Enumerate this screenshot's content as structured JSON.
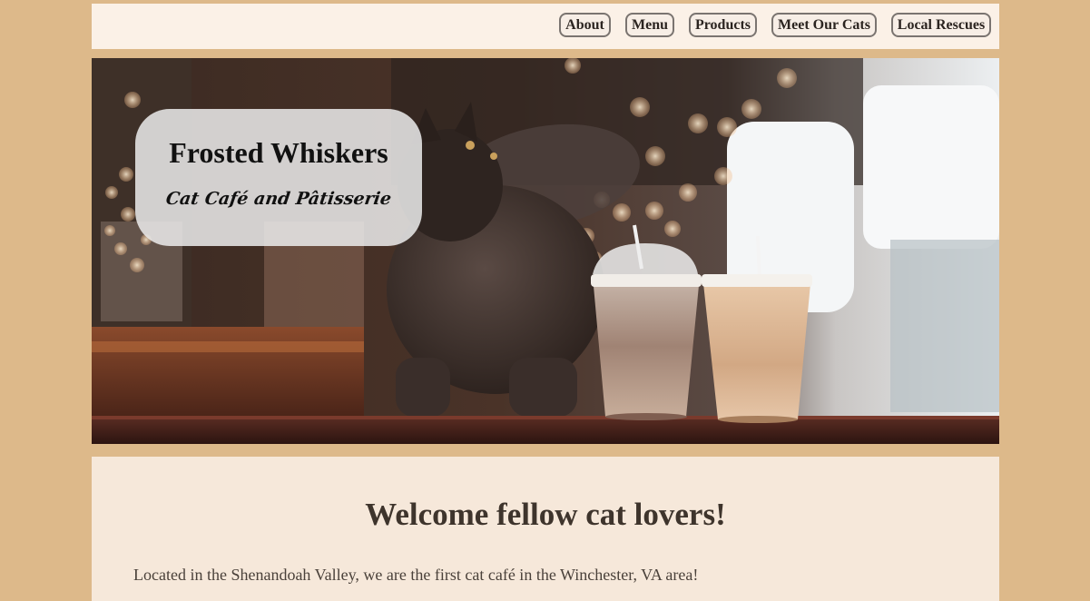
{
  "nav": {
    "items": [
      {
        "label": "About"
      },
      {
        "label": "Menu"
      },
      {
        "label": "Products"
      },
      {
        "label": "Meet Our Cats"
      },
      {
        "label": "Local Rescues"
      }
    ]
  },
  "hero": {
    "brand_name": "Frosted Whiskers",
    "tagline": "Cat Café and Pâtisserie"
  },
  "welcome": {
    "title": "Welcome fellow cat lovers!",
    "text": "Located in the Shenandoah Valley, we are the first cat café in the Winchester, VA area!"
  },
  "colors": {
    "page_background": "#ddb98a",
    "nav_background": "#fbf1e7",
    "welcome_background": "#f6e8da",
    "heading_text": "#3e342c"
  }
}
